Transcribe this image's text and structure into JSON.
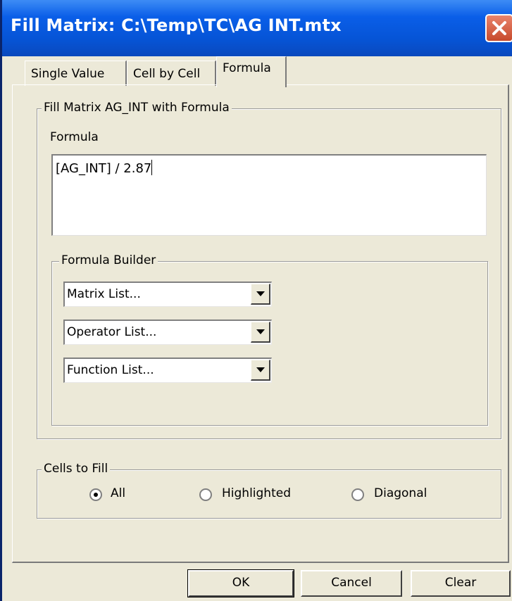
{
  "window": {
    "title": "Fill Matrix: C:\\Temp\\TC\\AG INT.mtx"
  },
  "tabs": [
    {
      "label": "Single Value",
      "active": false
    },
    {
      "label": "Cell by Cell",
      "active": false
    },
    {
      "label": "Formula",
      "active": true
    }
  ],
  "fill_group": {
    "legend": "Fill Matrix AG_INT with Formula",
    "formula_label": "Formula",
    "formula_value": "[AG_INT] / 2.87"
  },
  "builder": {
    "legend": "Formula Builder",
    "matrix_list": "Matrix List...",
    "operator_list": "Operator List...",
    "function_list": "Function List..."
  },
  "cells_to_fill": {
    "legend": "Cells to Fill",
    "options": [
      {
        "label": "All",
        "checked": true
      },
      {
        "label": "Highlighted",
        "checked": false
      },
      {
        "label": "Diagonal",
        "checked": false
      }
    ]
  },
  "buttons": {
    "ok": "OK",
    "cancel": "Cancel",
    "clear": "Clear"
  },
  "icons": {
    "close": "close-icon",
    "dropdown": "chevron-down-icon"
  },
  "colors": {
    "titlebar": "#0654d6",
    "close_button": "#d6593a",
    "dialog_face": "#ece9d8"
  }
}
